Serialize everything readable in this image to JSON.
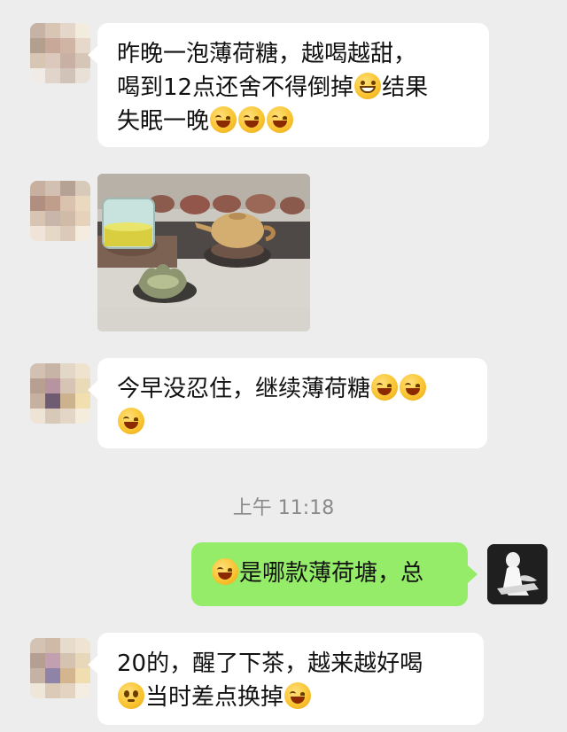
{
  "messages": [
    {
      "lines": [
        [
          {
            "text": "昨晚一泡薄荷糖，越喝越甜，"
          }
        ],
        [
          {
            "text": "喝到12点还舍不得倒掉"
          },
          {
            "emoji": "grin"
          },
          {
            "text": "结果"
          }
        ],
        [
          {
            "text": "失眠一晚"
          },
          {
            "emoji": "laugh-cry"
          },
          {
            "emoji": "laugh-cry"
          },
          {
            "emoji": "laugh-cry"
          }
        ]
      ]
    },
    {
      "lines": [
        [
          {
            "text": "今早没忍住，继续薄荷糖"
          },
          {
            "emoji": "laugh-cry"
          },
          {
            "emoji": "laugh-cry"
          }
        ],
        [
          {
            "emoji": "laugh-cry"
          }
        ]
      ]
    },
    {
      "lines": [
        [
          {
            "emoji": "laugh-cry"
          },
          {
            "text": "是哪款薄荷塘，总"
          }
        ]
      ]
    },
    {
      "lines": [
        [
          {
            "text": "20的，醒了下茶，越来越好喝"
          }
        ],
        [
          {
            "emoji": "dazed"
          },
          {
            "text": "当时差点换掉"
          },
          {
            "emoji": "laugh-cry"
          }
        ]
      ]
    }
  ],
  "timestamp": "上午 11:18",
  "colors": {
    "background": "#ededed",
    "incoming_bubble": "#ffffff",
    "outgoing_bubble": "#95ec69",
    "timestamp": "#8a8a8a"
  },
  "icons": {
    "avatar_blurred": "blurred-avatar",
    "avatar_self": "avatar-photo",
    "emoji_grin": "grinning-face",
    "emoji_laugh_cry": "face-with-tears-of-joy",
    "emoji_dazed": "flushed-face"
  }
}
